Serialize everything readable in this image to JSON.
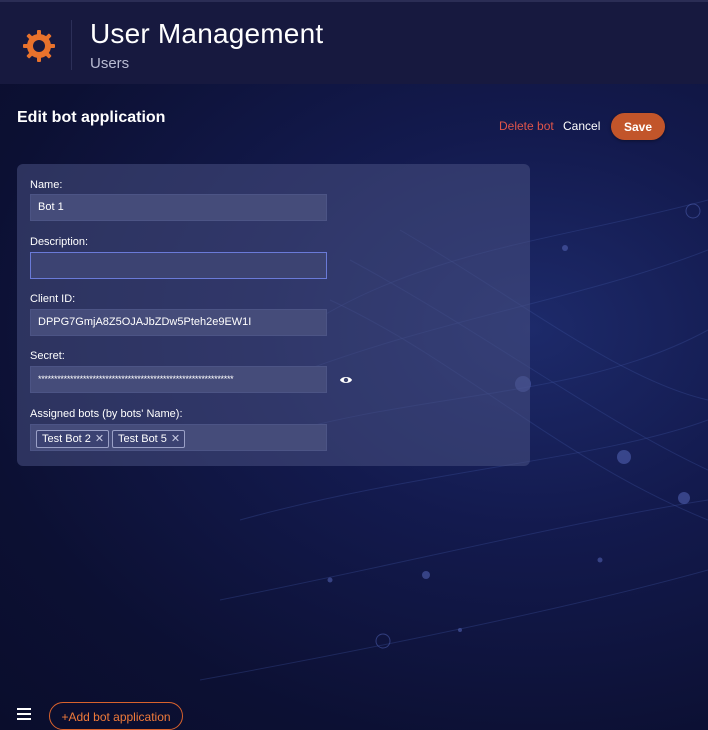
{
  "header": {
    "title": "User Management",
    "subtitle": "Users",
    "logo_icon": "gear-icon",
    "logo_color": "#e8722c"
  },
  "page": {
    "title": "Edit bot application"
  },
  "actions": {
    "delete_label": "Delete bot",
    "cancel_label": "Cancel",
    "save_label": "Save"
  },
  "form": {
    "name": {
      "label": "Name:",
      "value": "Bot 1"
    },
    "description": {
      "label": "Description:",
      "value": ""
    },
    "client_id": {
      "label": "Client ID:",
      "value": "DPPG7GmjA8Z5OJAJbZDw5Pteh2e9EW1I"
    },
    "secret": {
      "label": "Secret:",
      "value": "*************************************************************",
      "toggle_icon": "eye-icon"
    },
    "assigned_bots": {
      "label": "Assigned bots (by bots' Name):",
      "tags": [
        {
          "label": "Test Bot 2",
          "remove_icon": "close-icon"
        },
        {
          "label": "Test Bot 5",
          "remove_icon": "close-icon"
        }
      ]
    }
  },
  "footer": {
    "menu_icon": "hamburger-icon",
    "add_label": "+Add bot application"
  },
  "colors": {
    "accent": "#c2552a",
    "danger": "#e0554a"
  }
}
